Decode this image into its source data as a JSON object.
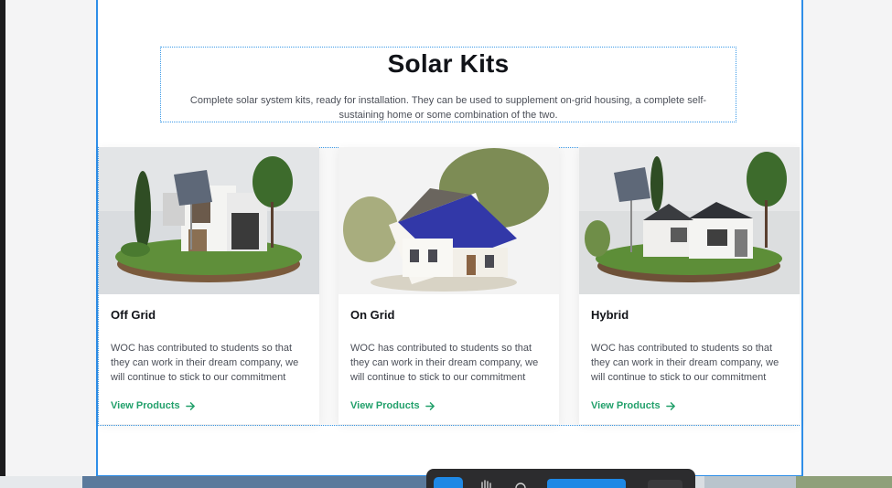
{
  "section": {
    "title": "Solar Kits",
    "subtitle": "Complete solar system kits, ready for installation. They can be used to supplement on-grid housing, a complete self-sustaining home or some combination of the two."
  },
  "cards": [
    {
      "title": "Off Grid",
      "description": "WOC has contributed to students so that they can work in their dream company, we will continue to stick to our commitment",
      "link": "View Products",
      "image_icon": "off-grid-house-image"
    },
    {
      "title": "On Grid",
      "description": "WOC has contributed to students so that they can work in their dream company, we will continue to stick to our commitment",
      "link": "View Products",
      "image_icon": "on-grid-house-image"
    },
    {
      "title": "Hybrid",
      "description": "WOC has contributed to students so that they can work in their dream company, we will continue to stick to our commitment",
      "link": "View Products",
      "image_icon": "hybrid-house-image"
    }
  ],
  "colors": {
    "accent_green": "#22a06b",
    "selection_blue": "#2e8ee8",
    "toolbar_dark": "#2c2c2e"
  },
  "toolbar": {
    "icons": [
      "move-tool-icon",
      "hand-tool-icon",
      "comment-tool-icon"
    ]
  }
}
